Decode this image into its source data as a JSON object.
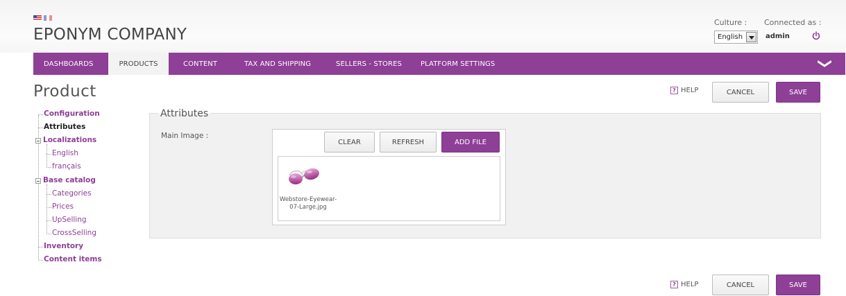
{
  "header": {
    "company": "EPONYM COMPANY",
    "culture_label": "Culture :",
    "connected_label": "Connected as :",
    "language": "English",
    "user": "admin"
  },
  "nav": {
    "items": [
      "DASHBOARDS",
      "PRODUCTS",
      "CONTENT",
      "TAX AND SHIPPING",
      "SELLERS - STORES",
      "PLATFORM SETTINGS"
    ],
    "active": "PRODUCTS"
  },
  "page": {
    "title": "Product",
    "help": "HELP",
    "cancel": "CANCEL",
    "save": "SAVE"
  },
  "tree": {
    "configuration": "Configuration",
    "attributes": "Attributes",
    "localizations": "Localizations",
    "english": "English",
    "francais": "français",
    "base_catalog": "Base catalog",
    "categories": "Categories",
    "prices": "Prices",
    "upselling": "UpSelling",
    "crossselling": "CrossSelling",
    "inventory": "Inventory",
    "content_items": "Content items"
  },
  "attributes": {
    "legend": "Attributes",
    "main_image_label": "Main Image :",
    "clear": "CLEAR",
    "refresh": "REFRESH",
    "add_file": "ADD FILE",
    "file_name_line1": "Webstore-Eyewear-",
    "file_name_line2": "07-Large.jpg"
  },
  "colors": {
    "accent": "#8e3f96",
    "panel": "#f1f1f1"
  }
}
